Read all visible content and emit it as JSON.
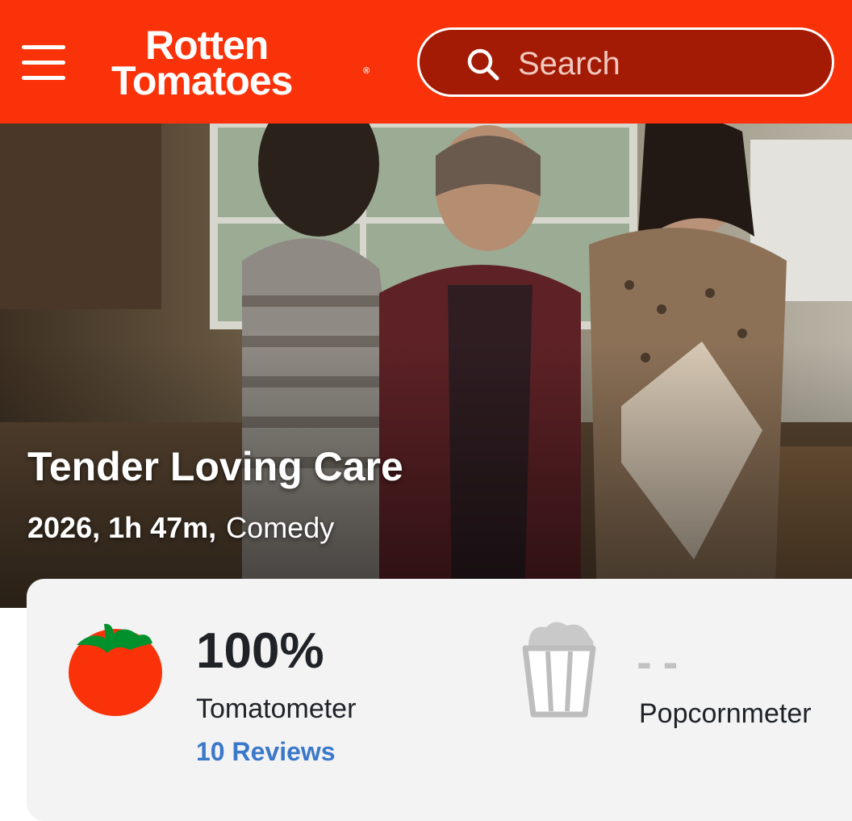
{
  "header": {
    "logo_line1": "Rotten",
    "logo_line2": "Tomatoes",
    "logo_reg": "®",
    "menu_icon": "hamburger-menu-icon",
    "search_icon": "search-icon",
    "search_placeholder": "Search",
    "brand_color": "#fa320a"
  },
  "movie": {
    "title": "Tender Loving Care",
    "year_runtime": "2026, 1h 47m,",
    "genre": "Comedy"
  },
  "scores": {
    "tomatometer_value": "100%",
    "tomatometer_label": "Tomatometer",
    "reviews_link": "10 Reviews",
    "tomatometer_icon": "fresh-tomato-icon",
    "popcornmeter_value": "--",
    "popcornmeter_label": "Popcornmeter",
    "popcornmeter_icon": "popcorn-bucket-icon",
    "link_color": "#3a78c9"
  }
}
